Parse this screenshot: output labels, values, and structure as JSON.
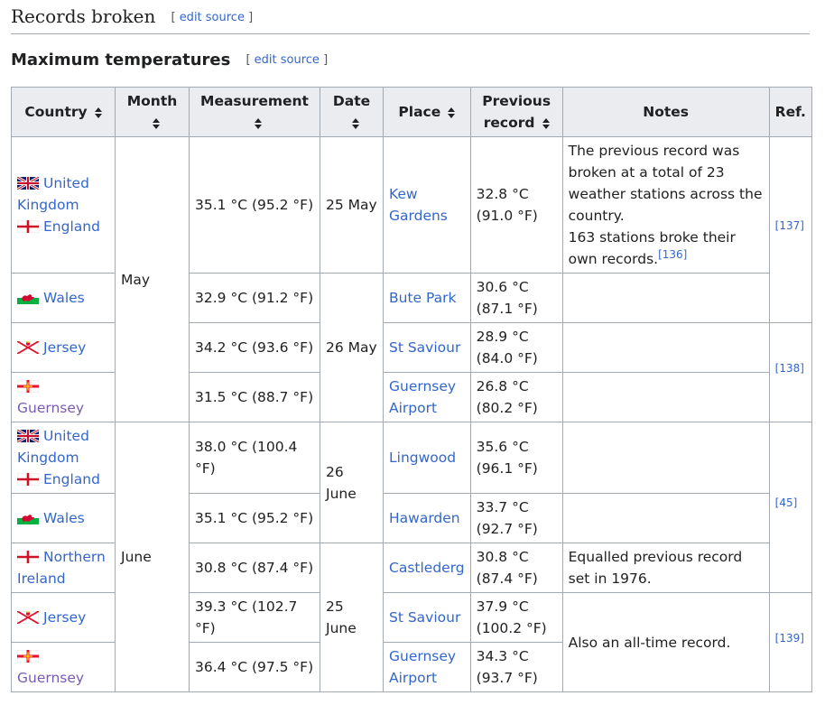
{
  "heading": {
    "title": "Records broken",
    "edit_open": "[",
    "edit_label": "edit source",
    "edit_close": "]"
  },
  "subheading": {
    "title": "Maximum temperatures",
    "edit_open": "[",
    "edit_label": "edit source",
    "edit_close": "]"
  },
  "columns": [
    "Country",
    "Month",
    "Measurement",
    "Date",
    "Place",
    "Previous record",
    "Notes",
    "Ref."
  ],
  "countries": {
    "uk": "United Kingdom",
    "england": "England",
    "wales": "Wales",
    "jersey": "Jersey",
    "guernsey": "Guernsey",
    "ni": "Northern Ireland"
  },
  "months": {
    "may": "May",
    "june": "June"
  },
  "dates": {
    "d25may": "25 May",
    "d26may": "26 May",
    "d26june": "26 June",
    "d25june": "25 June"
  },
  "rows": [
    {
      "measurement": "35.1 °C (95.2 °F)",
      "place": "Kew Gardens",
      "previous": "32.8 °C (91.0 °F)",
      "note1": "The previous record was broken at a total of 23 weather stations across the country.",
      "note2": "163 stations broke their own records.",
      "note_ref": "[136]",
      "ref": "[137]"
    },
    {
      "measurement": "32.9 °C (91.2 °F)",
      "place": "Bute Park",
      "previous": "30.6 °C (87.1 °F)"
    },
    {
      "measurement": "34.2 °C (93.6 °F)",
      "place": "St Saviour",
      "previous": "28.9 °C (84.0 °F)",
      "ref": "[138]"
    },
    {
      "measurement": "31.5 °C (88.7 °F)",
      "place": "Guernsey Airport",
      "previous": "26.8 °C (80.2 °F)"
    },
    {
      "measurement": "38.0 °C (100.4 °F)",
      "place": "Lingwood",
      "previous": "35.6 °C (96.1 °F)",
      "ref": "[45]"
    },
    {
      "measurement": "35.1 °C (95.2 °F)",
      "place": "Hawarden",
      "previous": "33.7 °C (92.7 °F)"
    },
    {
      "measurement": "30.8 °C (87.4 °F)",
      "place": "Castlederg",
      "previous": "30.8 °C (87.4 °F)",
      "note": "Equalled previous record set in 1976."
    },
    {
      "measurement": "39.3 °C (102.7 °F)",
      "place": "St Saviour",
      "previous": "37.9 °C (100.2 °F)",
      "note": "Also an all-time record.",
      "ref": "[139]"
    },
    {
      "measurement": "36.4 °C (97.5 °F)",
      "place": "Guernsey Airport",
      "previous": "34.3 °C (93.7 °F)"
    }
  ],
  "colors": {
    "link": "#3366cc",
    "visited": "#795cb2",
    "header_bg": "#eaecf0",
    "border": "#a2a9b1"
  },
  "icons": [
    "uk-flag-icon",
    "england-flag-icon",
    "wales-flag-icon",
    "jersey-flag-icon",
    "guernsey-flag-icon",
    "northern-ireland-flag-icon",
    "sort-icon"
  ]
}
